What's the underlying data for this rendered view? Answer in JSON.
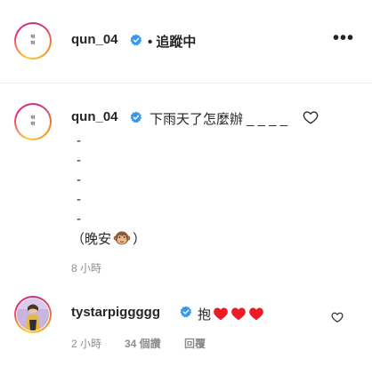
{
  "post_header": {
    "username": "qun_04",
    "follow_status": "• 追蹤中",
    "avatar_text": "啉\n啉",
    "more_icon": "ellipsis-icon"
  },
  "caption": {
    "username": "qun_04",
    "text": "下雨天了怎麼辦 _ _ _ _",
    "lines": [
      "-",
      "-",
      "-",
      "-",
      "-"
    ],
    "closing_prefix": "（晚安",
    "closing_suffix": "）",
    "time": "8 小時"
  },
  "comment": {
    "username": "tystarpiggggg",
    "text": "抱",
    "time": "2 小時",
    "likes": "34 個讚",
    "reply": "回覆"
  },
  "colors": {
    "verified_blue": "#3897f0",
    "heart_red": "#ed1c24",
    "muted_gray": "#8e8e8e",
    "text": "#262626"
  }
}
